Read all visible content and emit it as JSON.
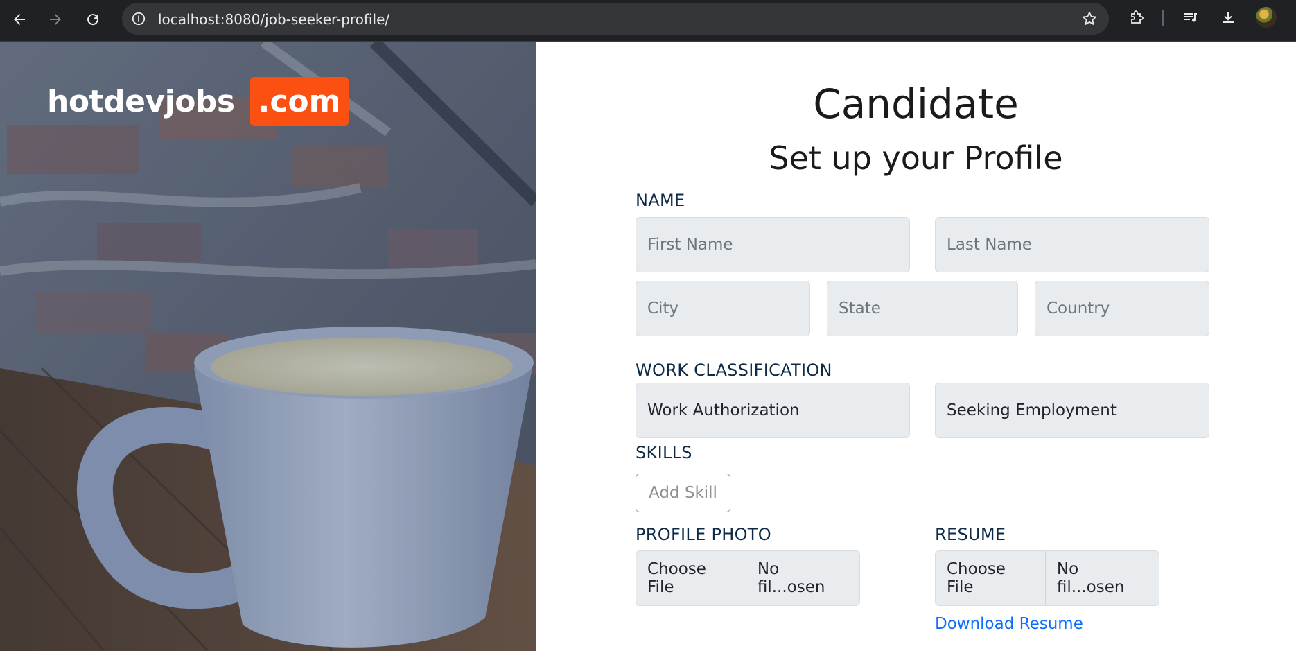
{
  "browser": {
    "url": "localhost:8080/job-seeker-profile/",
    "icons": [
      "back-arrow-icon",
      "forward-arrow-icon",
      "reload-icon",
      "site-info-icon",
      "bookmark-star-icon",
      "extensions-icon",
      "media-icon",
      "download-icon",
      "profile-avatar"
    ]
  },
  "brand": {
    "name": "hotdevjobs",
    "tld": ".com",
    "accent": "#fc4f12"
  },
  "header": {
    "title": "Candidate",
    "subtitle": "Set up your Profile"
  },
  "form": {
    "name_section": "NAME",
    "first_name_placeholder": "First Name",
    "last_name_placeholder": "Last Name",
    "city_placeholder": "City",
    "state_placeholder": "State",
    "country_placeholder": "Country",
    "work_section": "WORK CLASSIFICATION",
    "work_authorization": "Work Authorization",
    "seeking_employment": "Seeking Employment",
    "skills_section": "SKILLS",
    "add_skill": "Add Skill",
    "photo_section": "PROFILE PHOTO",
    "photo_choose": "Choose File",
    "photo_chosen": "No fil...osen",
    "resume_section": "RESUME",
    "resume_choose": "Choose File",
    "resume_chosen": "No fil...osen",
    "download_resume": "Download Resume"
  },
  "colors": {
    "link": "#0d6efd",
    "label": "#0e2a47",
    "field_bg": "#e9ecef"
  }
}
